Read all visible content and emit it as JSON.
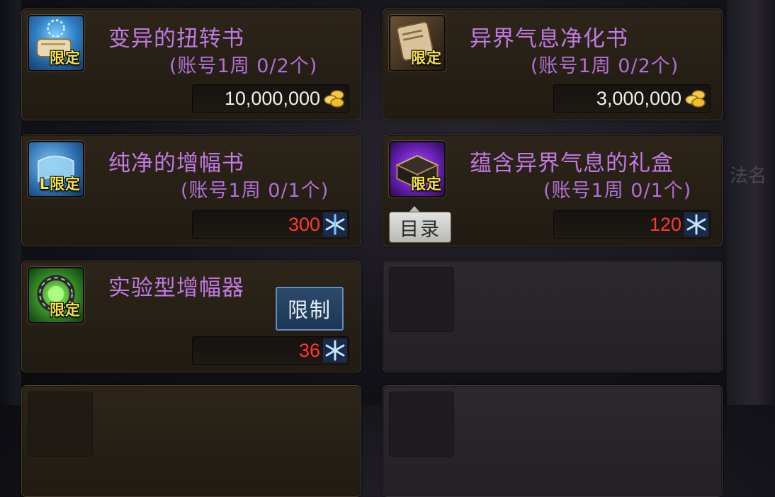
{
  "background": {
    "deco_text": "法名"
  },
  "shop": {
    "items": [
      {
        "title": "变异的扭转书",
        "subtitle": "(账号1周 0/2个)",
        "tag": "限定",
        "price": "10,000,000",
        "currency_icon": "gold-coin-icon",
        "price_color": "#f2efe8"
      },
      {
        "title": "异界气息净化书",
        "subtitle": "(账号1周 0/2个)",
        "tag": "限定",
        "price": "3,000,000",
        "currency_icon": "gold-coin-icon",
        "price_color": "#f2efe8"
      },
      {
        "title": "纯净的增幅书",
        "subtitle": "(账号1周 0/1个)",
        "tag": "L限定",
        "price": "300",
        "currency_icon": "crystal-icon",
        "price_color": "#ff3a2a"
      },
      {
        "title": "蕴含异界气息的礼盒",
        "subtitle": "(账号1周 0/1个)",
        "tag": "限定",
        "price": "120",
        "currency_icon": "crystal-icon",
        "price_color": "#ff3a2a",
        "button": "目录"
      },
      {
        "title": "实验型增幅器",
        "tag": "限定",
        "price": "36",
        "currency_icon": "crystal-icon",
        "price_color": "#ff3a2a",
        "button": "限制"
      }
    ]
  }
}
